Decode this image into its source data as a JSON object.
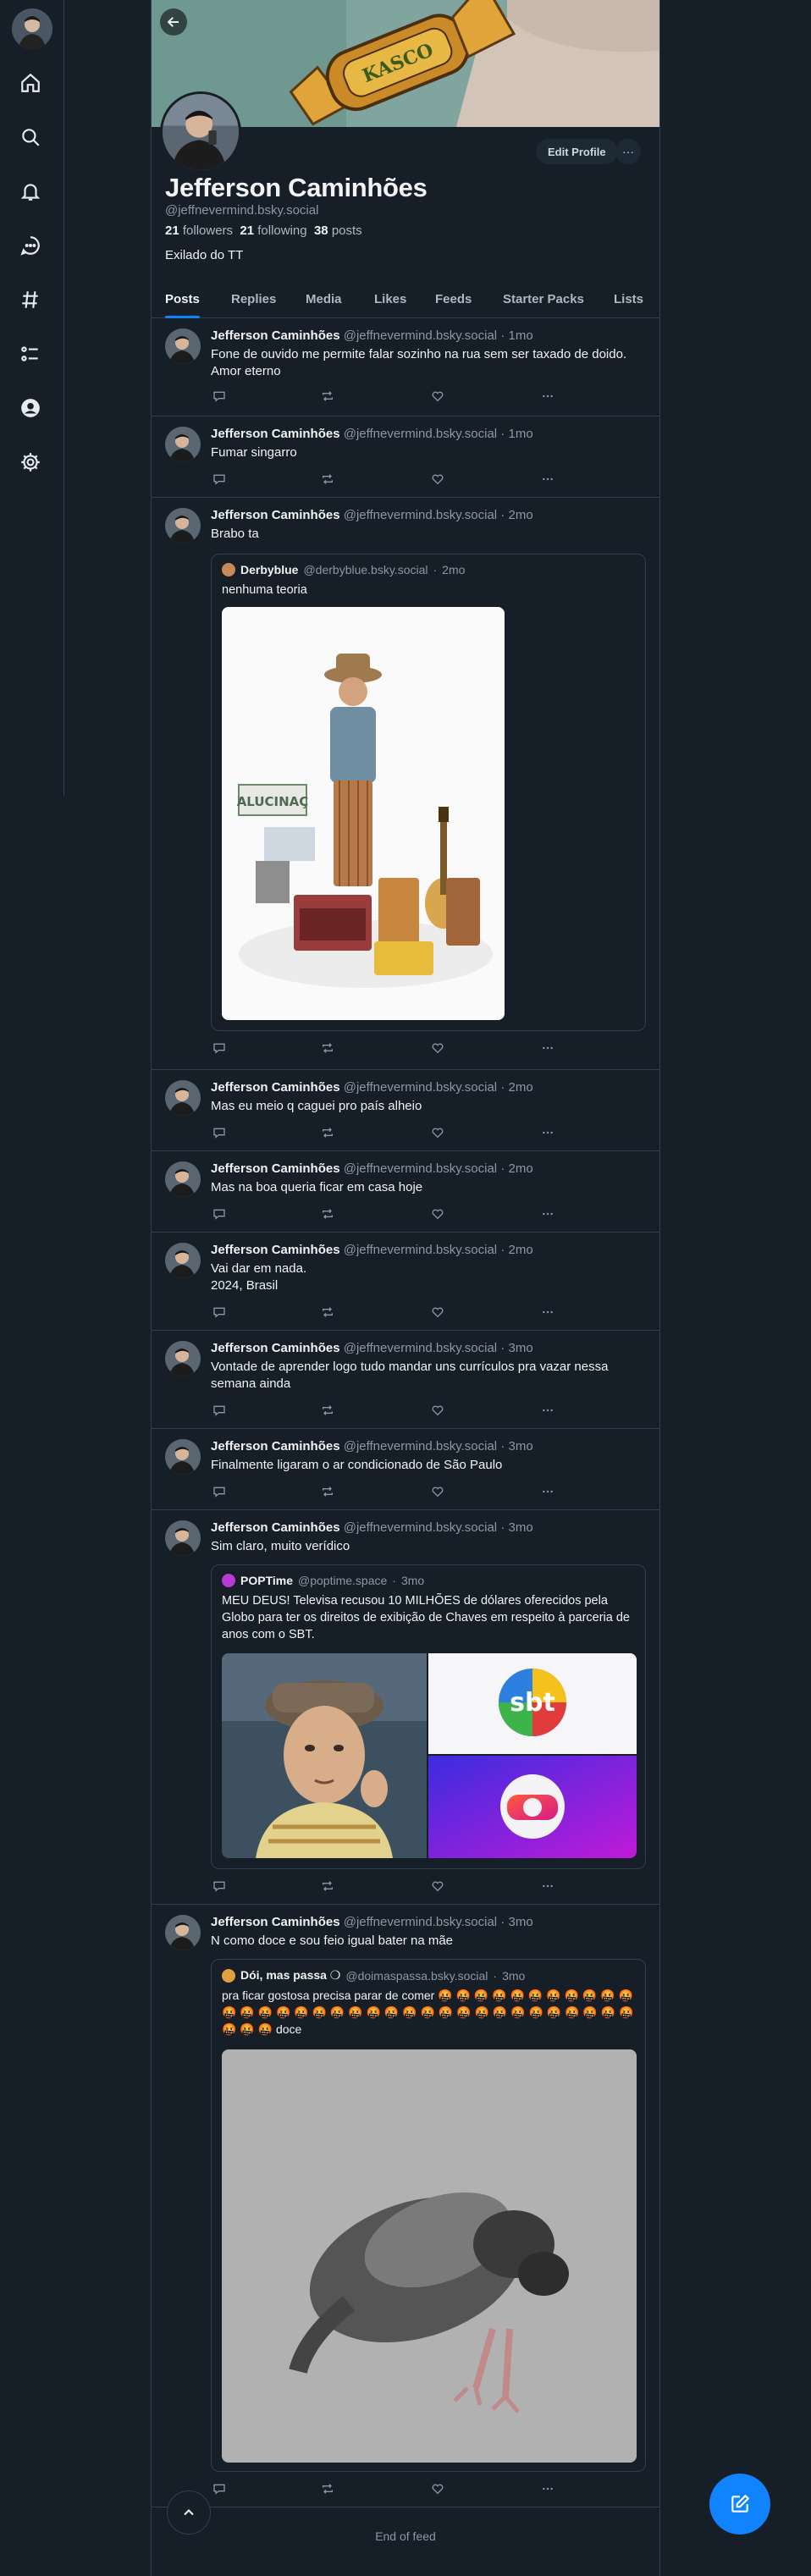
{
  "rail": {
    "avatar_alt": "",
    "icons": [
      "home-icon",
      "search-icon",
      "bell-icon",
      "chat-icon",
      "hashtag-icon",
      "list-icon",
      "profile-icon",
      "gear-icon"
    ]
  },
  "profile": {
    "display_name": "Jefferson Caminhões",
    "handle": "@jeffnevermind.bsky.social",
    "followers_count": "21",
    "followers_label": "followers",
    "following_count": "21",
    "following_label": "following",
    "posts_count": "38",
    "posts_label": "posts",
    "bio": "Exilado do TT",
    "edit_label": "Edit Profile",
    "more_label": "···"
  },
  "tabs": [
    "Posts",
    "Replies",
    "Media",
    "Likes",
    "Feeds",
    "Starter Packs",
    "Lists"
  ],
  "posts": [
    {
      "name": "Jefferson Caminhões",
      "handle": "@jeffnevermind.bsky.social",
      "time": "1mo",
      "text": "Fone de ouvido me permite falar sozinho na rua sem ser taxado de doido. Amor eterno"
    },
    {
      "name": "Jefferson Caminhões",
      "handle": "@jeffnevermind.bsky.social",
      "time": "1mo",
      "text": "Fumar singarro"
    },
    {
      "name": "Jefferson Caminhões",
      "handle": "@jeffnevermind.bsky.social",
      "time": "2mo",
      "text": "Brabo ta",
      "quote": {
        "name": "Derbyblue",
        "handle": "@derbyblue.bsky.social",
        "time": "2mo",
        "text": "nenhuma teoria",
        "image_text": "ALUCINAÇ"
      }
    },
    {
      "name": "Jefferson Caminhões",
      "handle": "@jeffnevermind.bsky.social",
      "time": "2mo",
      "text": "Mas eu meio q caguei pro país alheio"
    },
    {
      "name": "Jefferson Caminhões",
      "handle": "@jeffnevermind.bsky.social",
      "time": "2mo",
      "text": "Mas na boa queria ficar em casa hoje"
    },
    {
      "name": "Jefferson Caminhões",
      "handle": "@jeffnevermind.bsky.social",
      "time": "2mo",
      "text": "Vai dar em nada.\n2024, Brasil"
    },
    {
      "name": "Jefferson Caminhões",
      "handle": "@jeffnevermind.bsky.social",
      "time": "3mo",
      "text": "Vontade de aprender logo tudo mandar uns currículos pra vazar nessa semana ainda"
    },
    {
      "name": "Jefferson Caminhões",
      "handle": "@jeffnevermind.bsky.social",
      "time": "3mo",
      "text": "Finalmente ligaram o ar condicionado de São Paulo"
    },
    {
      "name": "Jefferson Caminhões",
      "handle": "@jeffnevermind.bsky.social",
      "time": "3mo",
      "text": "Sim claro, muito verídico",
      "quote": {
        "name": "POPTime",
        "handle": "@poptime.space",
        "time": "3mo",
        "text": "MEU DEUS! Televisa recusou 10 MILHÕES de dólares oferecidos pela Globo para ter os direitos de exibição de Chaves em respeito à parceria de anos com o SBT.",
        "image_text": "sbt"
      }
    },
    {
      "name": "Jefferson Caminhões",
      "handle": "@jeffnevermind.bsky.social",
      "time": "3mo",
      "text": "N como doce e sou feio igual bater na mãe",
      "quote": {
        "name": "Dói, mas passa ❍",
        "handle": "@doimaspassa.bsky.social",
        "time": "3mo",
        "text": "pra ficar gostosa precisa parar de comer 🤬 🤬 🤬 🤬 🤬 🤬 🤬 🤬 🤬 🤬 🤬 🤬 🤬 🤬 🤬 🤬 🤬 🤬 🤬 🤬 🤬 🤬 🤬 🤬 🤬 🤬 🤬 🤬 🤬 🤬 🤬 🤬 🤬 🤬 🤬 🤬 🤬 doce"
      }
    }
  ],
  "end_of_feed": "End of feed",
  "colors": {
    "accent": "#1083fe",
    "bg": "#161e27",
    "border": "#2e4052",
    "muted": "#8b98a5"
  }
}
